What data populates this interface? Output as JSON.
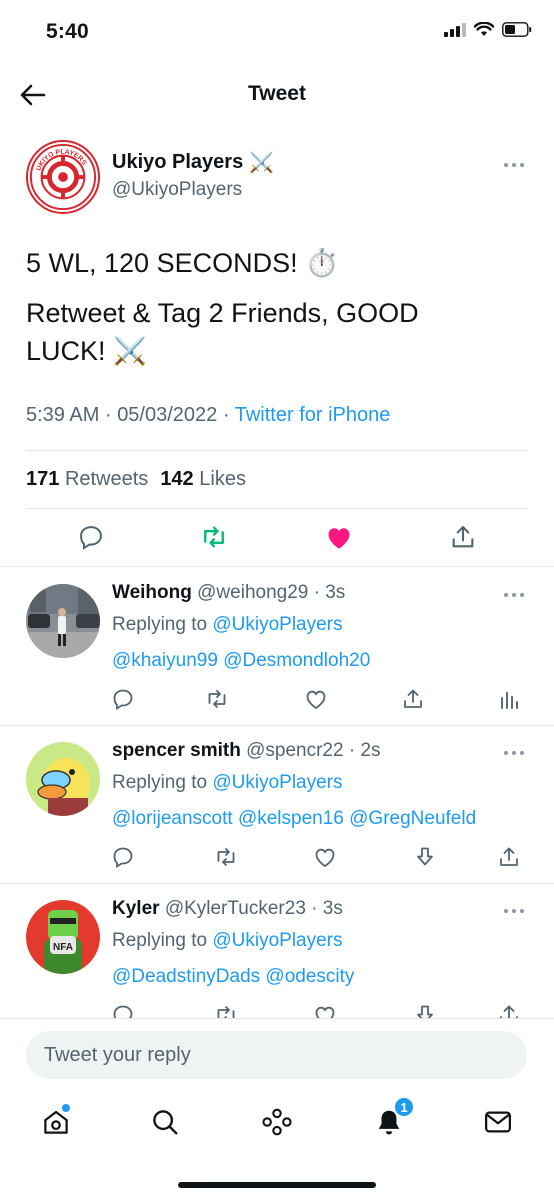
{
  "status_bar": {
    "time": "5:40"
  },
  "header": {
    "title": "Tweet"
  },
  "tweet": {
    "author_name": "Ukiyo Players",
    "author_emoji": "⚔️",
    "handle": "@UkiyoPlayers",
    "avatar_text": "UKIYO PLAYERS",
    "line1": "5 WL, 120 SECONDS! ⏱️",
    "line2": "Retweet & Tag 2 Friends, GOOD LUCK! ⚔️",
    "time": "5:39 AM",
    "date": "05/03/2022",
    "source": "Twitter for iPhone",
    "separator": "·",
    "retweet_count": "171",
    "retweet_label": "Retweets",
    "like_count": "142",
    "like_label": "Likes"
  },
  "replies": [
    {
      "name": "Weihong",
      "handle": "@weihong29",
      "time": "3s",
      "replying_prefix": "Replying to",
      "replying_to": "@UkiyoPlayers",
      "mentions": "@khaiyun99 @Desmondloh20"
    },
    {
      "name": "spencer smith",
      "handle": "@spencr22",
      "time": "2s",
      "replying_prefix": "Replying to",
      "replying_to": "@UkiyoPlayers",
      "mentions": "@lorijeanscott @kelspen16 @GregNeufeld"
    },
    {
      "name": "Kyler",
      "handle": "@KylerTucker23",
      "time": "3s",
      "replying_prefix": "Replying to",
      "replying_to": "@UkiyoPlayers",
      "mentions": "@DeadstinyDads @odescity"
    }
  ],
  "composer": {
    "placeholder": "Tweet your reply"
  },
  "tab_bar": {
    "notifications_badge": "1"
  },
  "colors": {
    "accent": "#1d9bf0",
    "like": "#f91880",
    "retweet": "#00ba7c",
    "text": "#0f1419",
    "secondary": "#536471"
  },
  "icons": [
    "back-arrow-icon",
    "more-icon",
    "reply-icon",
    "retweet-icon",
    "like-icon",
    "share-icon",
    "analytics-icon",
    "home-icon",
    "search-icon",
    "spaces-icon",
    "notifications-icon",
    "messages-icon"
  ]
}
